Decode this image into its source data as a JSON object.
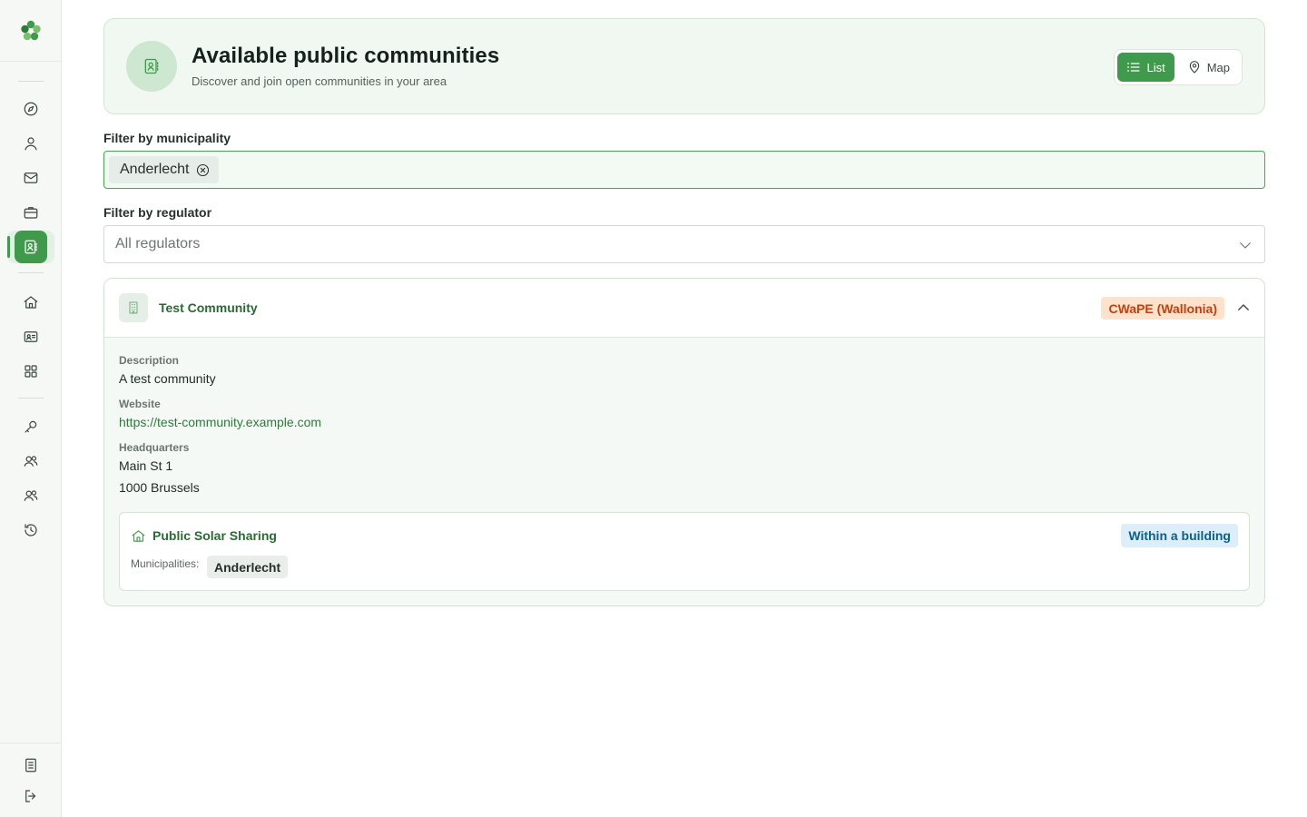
{
  "sidebar": {
    "logo_icon": "clover-logo-icon",
    "items": [
      {
        "name": "explore",
        "icon": "compass-icon"
      },
      {
        "name": "profile",
        "icon": "user-icon"
      },
      {
        "name": "messages",
        "icon": "mail-icon"
      },
      {
        "name": "jobs",
        "icon": "briefcase-icon"
      },
      {
        "name": "communities",
        "icon": "contact-book-icon",
        "active": true
      },
      {
        "name": "home",
        "icon": "home-icon"
      },
      {
        "name": "id-card",
        "icon": "id-card-icon"
      },
      {
        "name": "apps",
        "icon": "grid-icon"
      },
      {
        "name": "keys",
        "icon": "key-icon"
      },
      {
        "name": "members",
        "icon": "users-icon"
      },
      {
        "name": "groups",
        "icon": "users-icon"
      },
      {
        "name": "history",
        "icon": "history-icon"
      },
      {
        "name": "documents",
        "icon": "document-icon"
      },
      {
        "name": "logout",
        "icon": "logout-icon"
      }
    ]
  },
  "header": {
    "title": "Available public communities",
    "subtitle": "Discover and join open communities in your area",
    "view_toggle": {
      "list_label": "List",
      "map_label": "Map",
      "selected": "List"
    }
  },
  "filters": {
    "municipality": {
      "label": "Filter by municipality",
      "selected_chips": [
        "Anderlecht"
      ]
    },
    "regulator": {
      "label": "Filter by regulator",
      "value": "All regulators"
    }
  },
  "community": {
    "name": "Test Community",
    "regulator_badge": "CWaPE (Wallonia)",
    "description_label": "Description",
    "description": "A test community",
    "website_label": "Website",
    "website": "https://test-community.example.com",
    "headquarters_label": "Headquarters",
    "address_line1": "Main St 1",
    "address_line2": "1000 Brussels",
    "sharing": {
      "title": "Public Solar Sharing",
      "scope_badge": "Within a building",
      "municipalities_label": "Municipalities:",
      "municipalities": [
        "Anderlecht"
      ]
    }
  },
  "colors": {
    "accent": "#3f9b4b",
    "accent_dark": "#2a6a34",
    "regulator_badge_bg": "#fde3cc",
    "regulator_badge_fg": "#c2410c",
    "scope_badge_bg": "#dbeefa",
    "scope_badge_fg": "#0b5f8a"
  }
}
